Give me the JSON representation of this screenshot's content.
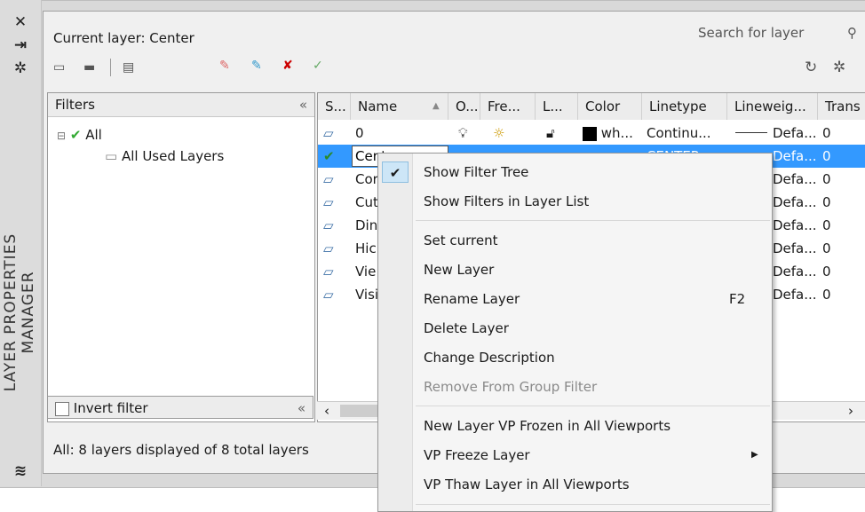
{
  "palette": {
    "vertical_title": "LAYER PROPERTIES MANAGER",
    "current_layer_label": "Current layer: Center",
    "search_placeholder": "Search for layer"
  },
  "filters": {
    "header": "Filters",
    "tree": [
      {
        "label": "All"
      },
      {
        "label": "All Used Layers"
      }
    ],
    "invert_label": "Invert filter",
    "status": "All: 8 layers displayed of 8 total layers"
  },
  "layer_list": {
    "columns": [
      "S...",
      "Name",
      "O...",
      "Fre...",
      "L...",
      "Color",
      "Linetype",
      "Lineweig...",
      "Trans"
    ],
    "rows": [
      {
        "name": "0",
        "color": "wh...",
        "linetype": "Continu...",
        "lineweight": "Defa...",
        "trans": "0",
        "selected": false
      },
      {
        "name": "Cent",
        "color": "",
        "linetype": "CENTER",
        "lineweight": "Defa...",
        "trans": "0",
        "selected": true
      },
      {
        "name": "Cor",
        "lineweight": "Defa...",
        "trans": "0",
        "selected": false
      },
      {
        "name": "Cut",
        "lineweight": "Defa...",
        "trans": "0",
        "selected": false
      },
      {
        "name": "Din",
        "lineweight": "Defa...",
        "trans": "0",
        "selected": false
      },
      {
        "name": "Hic",
        "lineweight": "Defa...",
        "trans": "0",
        "selected": false
      },
      {
        "name": "Vie",
        "lineweight": "Defa...",
        "trans": "0",
        "selected": false
      },
      {
        "name": "Visi",
        "lineweight": "Defa...",
        "trans": "0",
        "selected": false
      }
    ]
  },
  "context_menu": {
    "items": [
      {
        "label": "Show Filter Tree",
        "checked": true
      },
      {
        "label": "Show Filters in Layer List"
      },
      {
        "label": "Set current"
      },
      {
        "label": "New Layer"
      },
      {
        "label": "Rename Layer",
        "shortcut": "F2"
      },
      {
        "label": "Delete Layer"
      },
      {
        "label": "Change Description"
      },
      {
        "label": "Remove From Group Filter",
        "disabled": true
      },
      {
        "label": "New Layer VP Frozen in All Viewports"
      },
      {
        "label": "VP Freeze Layer",
        "submenu": true
      },
      {
        "label": "VP Thaw Layer in All Viewports"
      }
    ]
  },
  "colors": {
    "selection": "#3399ff",
    "panel": "#f0f0f0",
    "frame": "#d9d9d9"
  },
  "icons": {
    "close": "close-icon",
    "autohide": "autohide-icon",
    "properties": "properties-icon",
    "search": "search-icon",
    "refresh": "refresh-icon",
    "settings": "gear-icon"
  }
}
